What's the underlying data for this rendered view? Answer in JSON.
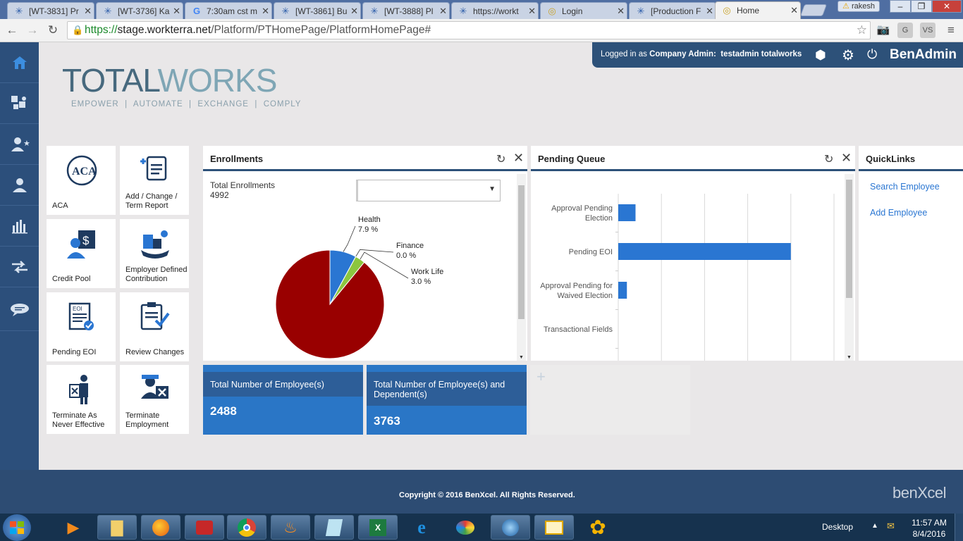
{
  "browser": {
    "tabs": [
      {
        "label": "[WT-3831] Pr",
        "icon": "jira-icon"
      },
      {
        "label": "[WT-3736] Ka",
        "icon": "jira-icon"
      },
      {
        "label": "7:30am cst m",
        "icon": "google-icon"
      },
      {
        "label": "[WT-3861] Bu",
        "icon": "jira-icon"
      },
      {
        "label": "[WT-3888] Pl",
        "icon": "jira-icon"
      },
      {
        "label": "https://workt",
        "icon": "jira-icon"
      },
      {
        "label": "Login",
        "icon": "globe-icon"
      },
      {
        "label": "[Production F",
        "icon": "jira-icon"
      },
      {
        "label": "Home",
        "icon": "globe-icon"
      }
    ],
    "profile": "rakesh",
    "url_secure": "https://",
    "url_host": "stage.workterra.net",
    "url_path": "/Platform/PTHomePage/PlatformHomePage#"
  },
  "header": {
    "logged_in_prefix": "Logged in as",
    "role": "Company Admin:",
    "user": "testadmin totalworks",
    "app_name": "BenAdmin"
  },
  "logo": {
    "total": "TOTAL",
    "works": "WORKS",
    "tagline": "EMPOWER  |  AUTOMATE  |  EXCHANGE  |  COMPLY"
  },
  "tiles": [
    {
      "label": "ACA"
    },
    {
      "label": "Add / Change / Term Report"
    },
    {
      "label": "Credit Pool"
    },
    {
      "label": "Employer Defined Contribution"
    },
    {
      "label": "Pending EOI"
    },
    {
      "label": "Review Changes"
    },
    {
      "label": "Terminate As Never Effective"
    },
    {
      "label": "Terminate Employment"
    }
  ],
  "enrollments": {
    "title": "Enrollments",
    "total_label": "Total Enrollments",
    "total_value": "4992",
    "dropdown_value": ""
  },
  "pending_queue": {
    "title": "Pending Queue"
  },
  "quicklinks": {
    "title": "QuickLinks",
    "links": [
      "Search Employee",
      "Add Employee"
    ]
  },
  "kpis": [
    {
      "label": "Total Number of Employee(s)",
      "value": "2488"
    },
    {
      "label": "Total Number of Employee(s) and Dependent(s)",
      "value": "3763"
    }
  ],
  "footer": {
    "copyright": "Copyright © 2016 BenXcel. All Rights Reserved.",
    "brand": "benXcel"
  },
  "taskbar": {
    "desktop_label": "Desktop",
    "time": "11:57 AM",
    "date": "8/4/2016"
  },
  "chart_data": [
    {
      "type": "pie",
      "slices": [
        {
          "label": "Health",
          "value": 7.9,
          "value_label": "7.9 %",
          "color": "#2a76d2"
        },
        {
          "label": "Finance",
          "value": 0.0,
          "value_label": "0.0 %",
          "color": "#4c8a2a"
        },
        {
          "label": "Work Life",
          "value": 3.0,
          "value_label": "3.0 %",
          "color": "#8cc63f"
        },
        {
          "label": "",
          "value": 89.1,
          "value_label": "",
          "color": "#990000"
        }
      ]
    },
    {
      "type": "bar",
      "orientation": "horizontal",
      "categories": [
        "Approval Pending Election",
        "Pending EOI",
        "Approval Pending for Waived Election",
        "Transactional Fields"
      ],
      "values": [
        2,
        20,
        1,
        0
      ],
      "xlim": [
        0,
        25
      ],
      "grid": true,
      "color": "#2a76d2"
    }
  ]
}
